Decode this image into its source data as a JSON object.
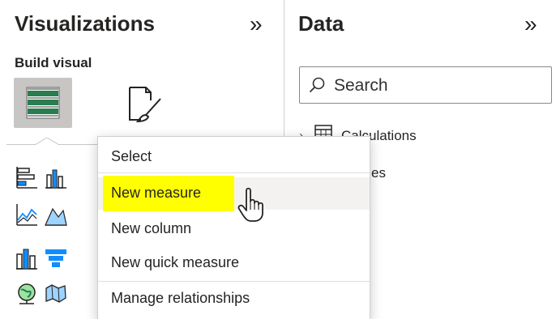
{
  "visualizations": {
    "title": "Visualizations",
    "collapse_glyph": "»",
    "build_visual_label": "Build visual",
    "tabs": [
      {
        "icon": "table-visual-icon",
        "active": true
      },
      {
        "icon": "format-paintbrush-icon",
        "active": false
      }
    ],
    "gallery_icons": [
      "stacked-bar-chart-icon",
      "clustered-column-chart-icon",
      "line-chart-icon",
      "area-chart-icon",
      "ribbon-chart-icon",
      "funnel-chart-icon",
      "globe-map-icon",
      "shape-map-icon"
    ]
  },
  "data_pane": {
    "title": "Data",
    "collapse_glyph": "»",
    "search_placeholder": "Search",
    "tree": [
      {
        "chevron": "›",
        "icon": "table-icon",
        "label": "Calculations"
      },
      {
        "label": "es"
      }
    ]
  },
  "context_menu": {
    "header": "Select",
    "items": [
      {
        "label": "New measure",
        "highlighted": true
      },
      {
        "label": "New column"
      },
      {
        "label": "New quick measure"
      },
      {
        "label": "Manage relationships"
      }
    ]
  },
  "colors": {
    "highlight": "#ffff00",
    "text": "#252423",
    "table_icon_green": "#217346",
    "funnel_blue": "#118dff",
    "panel_border": "#d2d0ce"
  }
}
